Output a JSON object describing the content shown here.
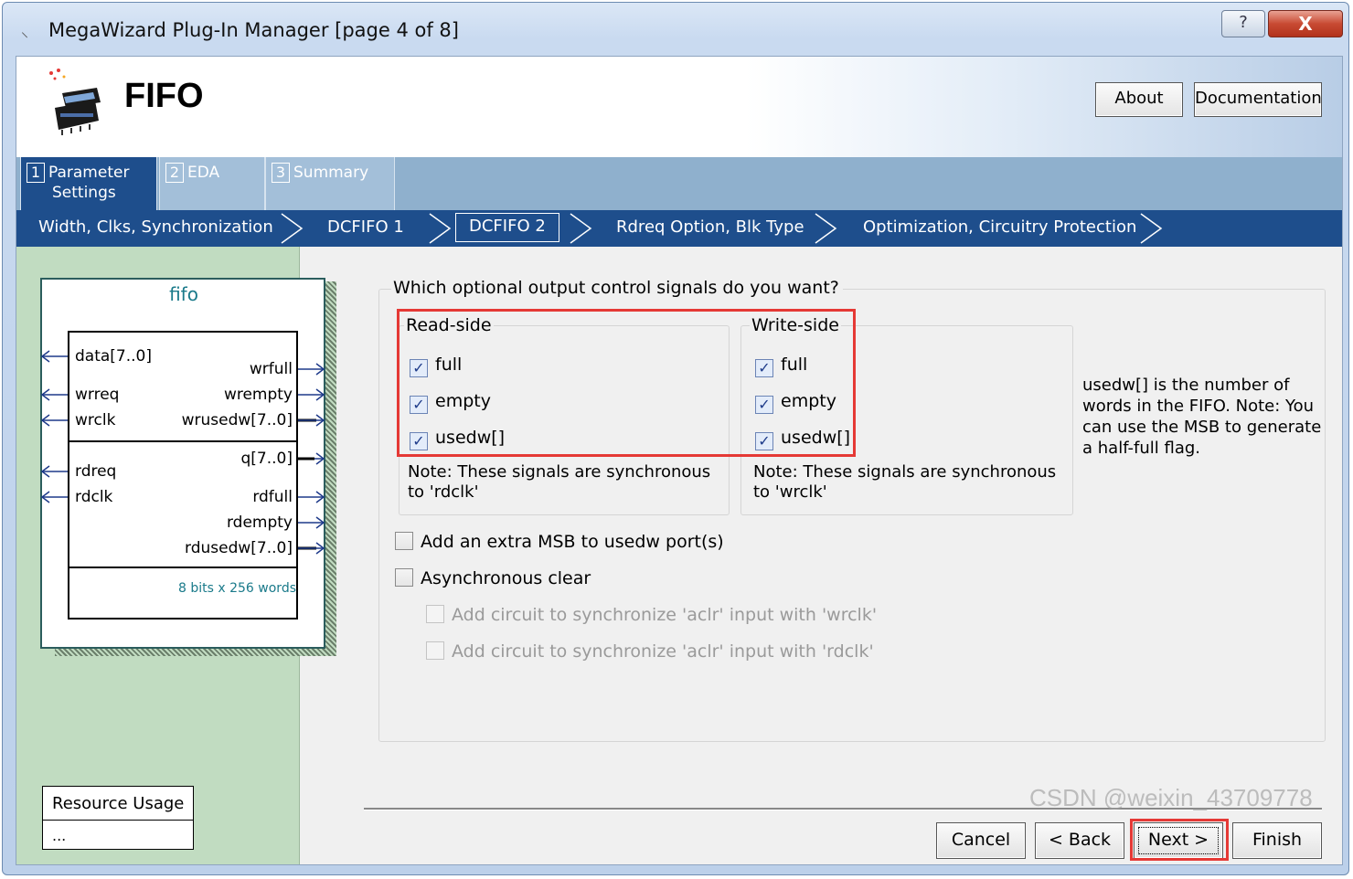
{
  "window": {
    "title": "MegaWizard Plug-In Manager [page 4 of 8]",
    "help_label": "?",
    "close_label": "X"
  },
  "header": {
    "title": "FIFO",
    "about_label": "About",
    "documentation_label": "Documentation"
  },
  "tabs": [
    {
      "num": "1",
      "label_line1": "Parameter",
      "label_line2": "Settings",
      "active": true
    },
    {
      "num": "2",
      "label_line1": "EDA",
      "active": false
    },
    {
      "num": "3",
      "label_line1": "Summary",
      "active": false
    }
  ],
  "breadcrumb": [
    {
      "label": "Width, Clks, Synchronization"
    },
    {
      "label": "DCFIFO 1"
    },
    {
      "label": "DCFIFO 2",
      "current": true
    },
    {
      "label": "Rdreq Option, Blk Type"
    },
    {
      "label": "Optimization, Circuitry Protection"
    }
  ],
  "symbol": {
    "title": "fifo",
    "pins": {
      "data": "data[7..0]",
      "wrreq": "wrreq",
      "wrclk": "wrclk",
      "rdreq": "rdreq",
      "rdclk": "rdclk",
      "wrfull": "wrfull",
      "wrempty": "wrempty",
      "wrusedw": "wrusedw[7..0]",
      "q": "q[7..0]",
      "rdfull": "rdfull",
      "rdempty": "rdempty",
      "rdusedw": "rdusedw[7..0]"
    },
    "size_text": "8 bits x 256 words"
  },
  "resource": {
    "title": "Resource Usage",
    "value": "..."
  },
  "main": {
    "question": "Which optional output control signals do you want?",
    "read_side": {
      "title": "Read-side",
      "options": [
        {
          "label": "full",
          "checked": true
        },
        {
          "label": "empty",
          "checked": true
        },
        {
          "label": "usedw[]",
          "checked": true
        }
      ],
      "note": "Note: These signals are synchronous to 'rdclk'"
    },
    "write_side": {
      "title": "Write-side",
      "options": [
        {
          "label": "full",
          "checked": true
        },
        {
          "label": "empty",
          "checked": true
        },
        {
          "label": "usedw[]",
          "checked": true
        }
      ],
      "note": "Note: These signals are synchronous to 'wrclk'"
    },
    "usedw_note": "usedw[] is the number of words in the FIFO. Note: You can use the MSB to generate a half-full flag.",
    "extra_msb": {
      "label": "Add an extra MSB to usedw port(s)",
      "checked": false
    },
    "async_clear": {
      "label": "Asynchronous clear",
      "checked": false
    },
    "sync_wrclk": {
      "label": "Add circuit to synchronize 'aclr' input with 'wrclk'",
      "checked": false,
      "enabled": false
    },
    "sync_rdclk": {
      "label": "Add circuit to synchronize 'aclr' input with 'rdclk'",
      "checked": false,
      "enabled": false
    }
  },
  "footer": {
    "cancel_label": "Cancel",
    "back_label": "< Back",
    "next_label": "Next >",
    "finish_label": "Finish"
  },
  "watermark": "CSDN @weixin_43709778",
  "colors": {
    "accent_dark": "#1e4e8c",
    "tab_inactive": "#a3bfd9",
    "left_panel": "#c1dcc1",
    "highlight_red": "#e53935",
    "symbol_teal": "#1a7a8a"
  }
}
